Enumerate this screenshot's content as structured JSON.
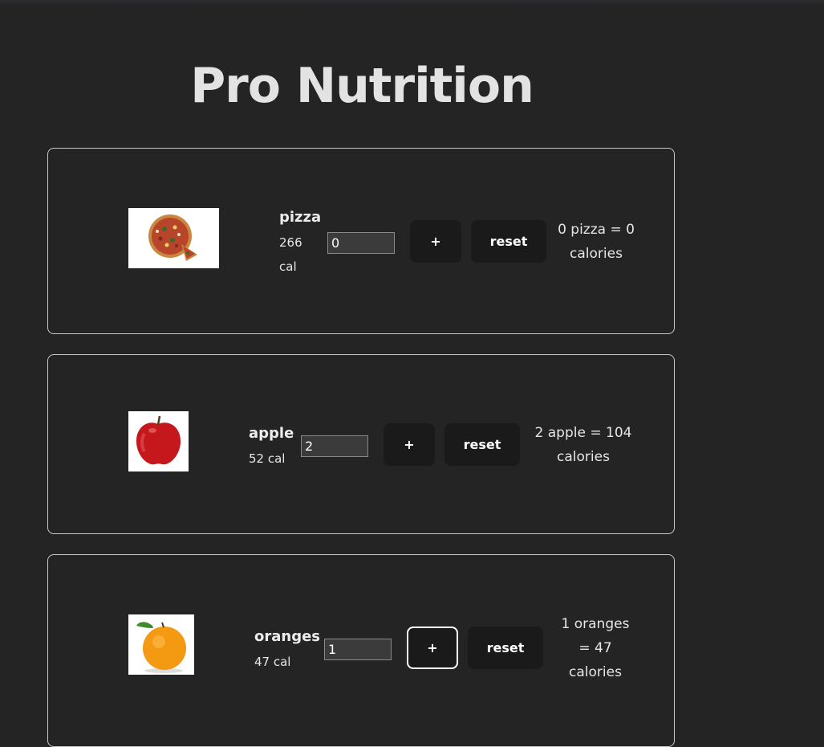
{
  "title": "Pro Nutrition",
  "foods": [
    {
      "name": "pizza",
      "cal_number": "266",
      "cal_unit": "cal",
      "quantity": "0",
      "plus_label": "+",
      "reset_label": "reset",
      "result_line1": "0 pizza = 0",
      "result_line2": "calories"
    },
    {
      "name": "apple",
      "cal": "52 cal",
      "quantity": "2",
      "plus_label": "+",
      "reset_label": "reset",
      "result_line1": "2 apple = 104",
      "result_line2": "calories"
    },
    {
      "name": "oranges",
      "cal": "47 cal",
      "quantity": "1",
      "plus_label": "+",
      "reset_label": "reset",
      "result_line1": "1 oranges",
      "result_line2": "= 47",
      "result_line3": "calories"
    }
  ],
  "colors": {
    "background": "#242424",
    "button": "#1a1a1a",
    "input": "#3b3b3b",
    "card_border": "#c9c9c9"
  },
  "icons": [
    "pizza-image",
    "apple-image",
    "orange-image"
  ]
}
